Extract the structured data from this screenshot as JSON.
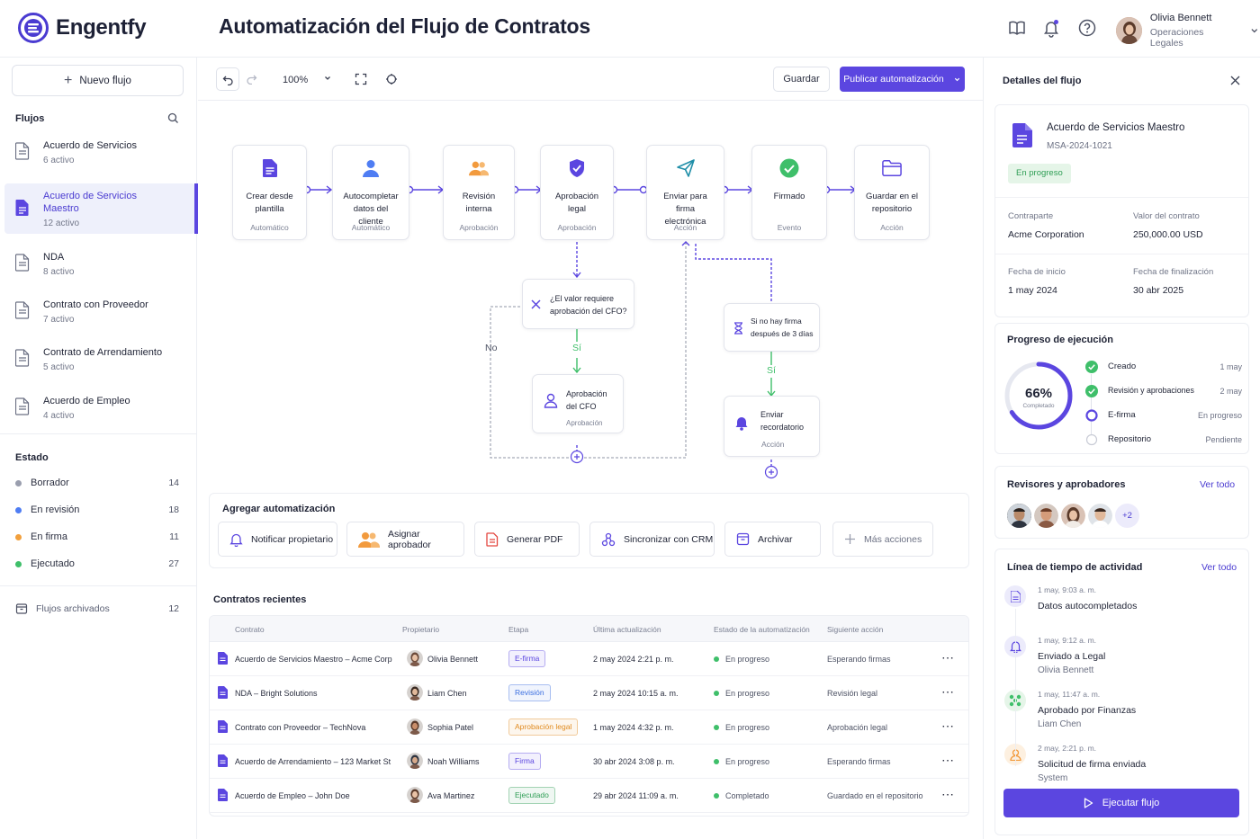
{
  "app": {
    "name": "Engentfy",
    "title": "Automatización del Flujo de Contratos"
  },
  "user": {
    "name": "Olivia Bennett",
    "role": "Operaciones Legales"
  },
  "header_icons": [
    "book-icon",
    "bell-icon",
    "help-icon",
    "chevron-down-icon"
  ],
  "sidebar": {
    "new_flow": "Nuevo flujo",
    "flows_heading": "Flujos",
    "flows": [
      {
        "name": "Acuerdo de Servicios",
        "count": "6 activo"
      },
      {
        "name": "Acuerdo de Servicios Maestro",
        "count": "12 activo"
      },
      {
        "name": "NDA",
        "count": "8 activo"
      },
      {
        "name": "Contrato con Proveedor",
        "count": "7 activo"
      },
      {
        "name": "Contrato de Arrendamiento",
        "count": "5 activo"
      },
      {
        "name": "Acuerdo de Empleo",
        "count": "4 activo"
      }
    ],
    "status_heading": "Estado",
    "statuses": [
      {
        "label": "Borrador",
        "count": "14",
        "color": "#9a9eae"
      },
      {
        "label": "En revisión",
        "count": "18",
        "color": "#4f7df3"
      },
      {
        "label": "En firma",
        "count": "11",
        "color": "#f2a03d"
      },
      {
        "label": "Ejecutado",
        "count": "27",
        "color": "#3fbf6a"
      }
    ],
    "archived": {
      "label": "Flujos archivados",
      "count": "12"
    }
  },
  "toolbar": {
    "zoom": "100%",
    "save": "Guardar",
    "publish": "Publicar automatización"
  },
  "workflow": {
    "nodes": [
      {
        "title": "Crear desde plantilla",
        "type": "Automático",
        "icon": "document-icon"
      },
      {
        "title": "Autocompletar datos del cliente",
        "type": "Automático",
        "icon": "user-icon"
      },
      {
        "title": "Revisión interna",
        "type": "Aprobación",
        "icon": "users-icon"
      },
      {
        "title": "Aprobación legal",
        "type": "Aprobación",
        "icon": "shield-icon"
      },
      {
        "title": "Enviar para firma electrónica",
        "type": "Acción",
        "icon": "send-icon"
      },
      {
        "title": "Firmado",
        "type": "Evento",
        "icon": "check-circle-icon"
      },
      {
        "title": "Guardar en el repositorio",
        "type": "Acción",
        "icon": "folder-icon"
      }
    ],
    "condition": {
      "text": "¿El valor requiere aprobación del CFO?",
      "yes": "Sí",
      "no": "No"
    },
    "cfo": {
      "title": "Aprobación del CFO",
      "type": "Aprobación"
    },
    "wait": {
      "text": "Si no hay firma después de 3 días",
      "yes": "Sí"
    },
    "reminder": {
      "title": "Enviar recordatorio",
      "type": "Acción"
    }
  },
  "automation": {
    "title": "Agregar automatización",
    "actions": [
      {
        "label": "Notificar propietario",
        "icon": "bell-icon"
      },
      {
        "label": "Asignar aprobador",
        "icon": "users-icon"
      },
      {
        "label": "Generar PDF",
        "icon": "pdf-icon"
      },
      {
        "label": "Sincronizar con CRM",
        "icon": "sync-icon"
      },
      {
        "label": "Archivar",
        "icon": "archive-icon"
      },
      {
        "label": "Más acciones",
        "icon": "plus-icon"
      }
    ]
  },
  "recent": {
    "title": "Contratos recientes",
    "columns": [
      "Contrato",
      "Propietario",
      "Etapa",
      "Última actualización",
      "Estado de la automatización",
      "Siguiente acción"
    ],
    "rows": [
      {
        "contract": "Acuerdo de Servicios Maestro – Acme Corp",
        "owner": "Olivia Bennett",
        "stage": "E-firma",
        "stage_color": "#5b46e0",
        "updated": "2 may 2024 2:21 p. m.",
        "status": "En progreso",
        "status_color": "#3fbf6a",
        "next": "Esperando firmas"
      },
      {
        "contract": "NDA – Bright Solutions",
        "owner": "Liam Chen",
        "stage": "Revisión",
        "stage_color": "#3b6fe0",
        "updated": "2 may 2024 10:15 a. m.",
        "status": "En progreso",
        "status_color": "#3fbf6a",
        "next": "Revisión legal"
      },
      {
        "contract": "Contrato con Proveedor – TechNova",
        "owner": "Sophia Patel",
        "stage": "Aprobación legal",
        "stage_color": "#e08a1e",
        "updated": "1 may 2024 4:32 p. m.",
        "status": "En progreso",
        "status_color": "#3fbf6a",
        "next": "Aprobación legal"
      },
      {
        "contract": "Acuerdo de Arrendamiento – 123 Market St",
        "owner": "Noah Williams",
        "stage": "Firma",
        "stage_color": "#5b46e0",
        "updated": "30 abr 2024 3:08 p. m.",
        "status": "En progreso",
        "status_color": "#3fbf6a",
        "next": "Esperando firmas"
      },
      {
        "contract": "Acuerdo de Empleo – John Doe",
        "owner": "Ava Martinez",
        "stage": "Ejecutado",
        "stage_color": "#2f9e55",
        "updated": "29 abr 2024 11:09 a. m.",
        "status": "Completado",
        "status_color": "#3fbf6a",
        "next": "Guardado en el repositorio"
      }
    ]
  },
  "details": {
    "title": "Detalles del flujo",
    "doc_name": "Acuerdo de Servicios Maestro",
    "doc_id": "MSA-2024-1021",
    "badge": "En progreso",
    "counterparty_label": "Contraparte",
    "counterparty": "Acme Corporation",
    "value_label": "Valor del contrato",
    "value": "250,000.00 USD",
    "start_label": "Fecha de inicio",
    "start": "1 may 2024",
    "end_label": "Fecha de finalización",
    "end": "30 abr 2025"
  },
  "progress": {
    "title": "Progreso de ejecución",
    "percent": "66%",
    "percent_value": 0.66,
    "caption": "Completado",
    "steps": [
      {
        "label": "Creado",
        "date": "1 may",
        "state": "done"
      },
      {
        "label": "Revisión y aprobaciones",
        "date": "2 may",
        "state": "done"
      },
      {
        "label": "E-firma",
        "date": "En progreso",
        "state": "current"
      },
      {
        "label": "Repositorio",
        "date": "Pendiente",
        "state": "pending"
      }
    ]
  },
  "reviewers": {
    "title": "Revisores y aprobadores",
    "link": "Ver todo",
    "more": "+2"
  },
  "timeline": {
    "title": "Línea de tiempo de actividad",
    "link": "Ver todo",
    "items": [
      {
        "date": "1 may, 9:03 a. m.",
        "title": "Datos autocompletados",
        "sub": "",
        "icon": "document-icon"
      },
      {
        "date": "1 may, 9:12 a. m.",
        "title": "Enviado a Legal",
        "sub": "Olivia Bennett",
        "icon": "bell-icon"
      },
      {
        "date": "1 may, 11:47 a. m.",
        "title": "Aprobado por Finanzas",
        "sub": "Liam Chen",
        "icon": "network-icon"
      },
      {
        "date": "2 may, 2:21 p. m.",
        "title": "Solicitud de firma enviada",
        "sub": "System",
        "icon": "user-icon"
      }
    ]
  },
  "run_button": "Ejecutar flujo"
}
